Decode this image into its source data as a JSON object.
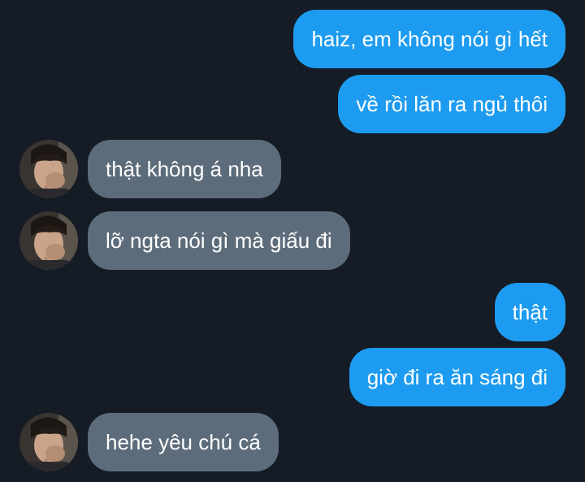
{
  "colors": {
    "background": "#151c25",
    "sent_bubble": "#1d9bf0",
    "received_bubble": "#5d6c7b",
    "text": "#ffffff"
  },
  "messages": [
    {
      "direction": "sent",
      "text": "haiz, em không nói gì hết"
    },
    {
      "direction": "sent",
      "text": "về rồi lăn ra ngủ thôi"
    },
    {
      "direction": "received",
      "text": "thật không á nha",
      "avatar": "user-avatar-photo"
    },
    {
      "direction": "received",
      "text": "lỡ ngta nói gì mà giấu đi",
      "avatar": "user-avatar-photo"
    },
    {
      "direction": "sent",
      "text": "thật"
    },
    {
      "direction": "sent",
      "text": "giờ đi ra ăn sáng đi"
    },
    {
      "direction": "received",
      "text": "hehe yêu chú cá",
      "avatar": "user-avatar-photo"
    }
  ]
}
